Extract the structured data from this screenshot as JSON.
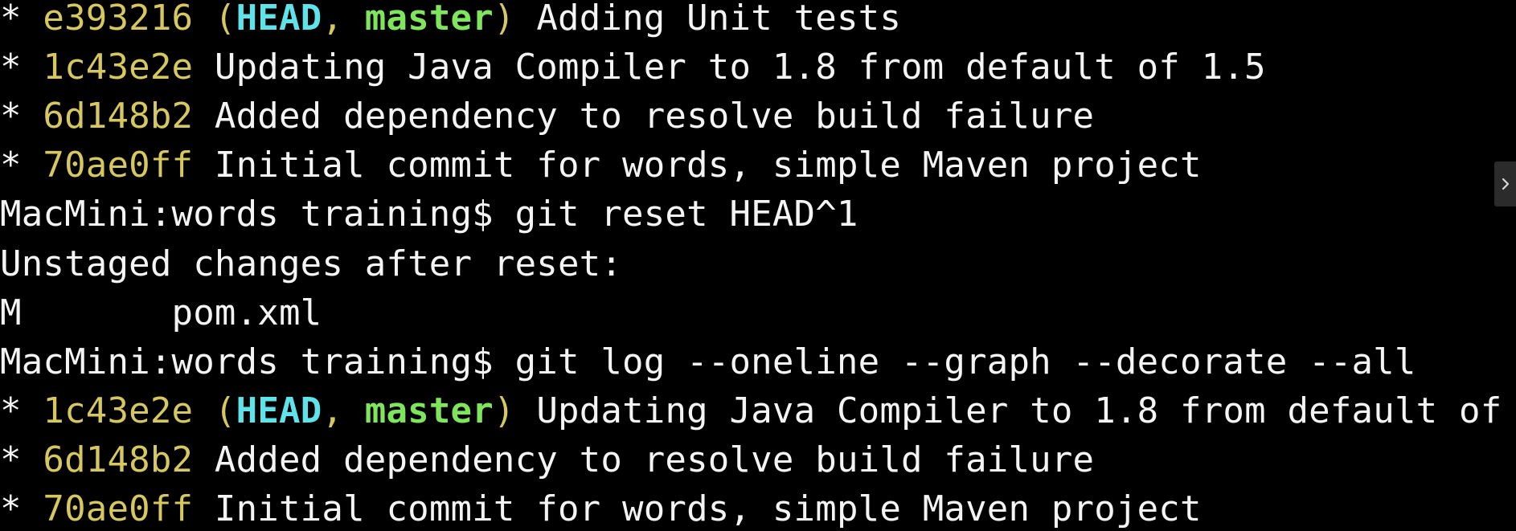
{
  "terminal": {
    "background": "#000000",
    "colors": {
      "text": "#f4f4f4",
      "hash": "#d6c85f",
      "head": "#5fe3e8",
      "branch": "#7ee55c"
    },
    "log1": [
      {
        "graph": "* ",
        "hash": "e393216",
        "open": " (",
        "head": "HEAD",
        "sep": ", ",
        "branch": "master",
        "close": ")",
        "message": " Adding Unit tests"
      },
      {
        "graph": "* ",
        "hash": "1c43e2e",
        "message": " Updating Java Compiler to 1.8 from default of 1.5"
      },
      {
        "graph": "* ",
        "hash": "6d148b2",
        "message": " Added dependency to resolve build failure"
      },
      {
        "graph": "* ",
        "hash": "70ae0ff",
        "message": " Initial commit for words, simple Maven project"
      }
    ],
    "prompt1": "MacMini:words training$ git reset HEAD^1",
    "output1": "Unstaged changes after reset:",
    "output2": "M       pom.xml",
    "prompt2": "MacMini:words training$ git log --oneline --graph --decorate --all",
    "log2": [
      {
        "graph": "* ",
        "hash": "1c43e2e",
        "open": " (",
        "head": "HEAD",
        "sep": ", ",
        "branch": "master",
        "close": ")",
        "message": " Updating Java Compiler to 1.8 from default of"
      },
      {
        "graph": "* ",
        "hash": "6d148b2",
        "message": " Added dependency to resolve build failure"
      },
      {
        "graph": "* ",
        "hash": "70ae0ff",
        "message": " Initial commit for words, simple Maven project"
      }
    ],
    "scroll_tab_icon": "chevron-right-icon"
  }
}
